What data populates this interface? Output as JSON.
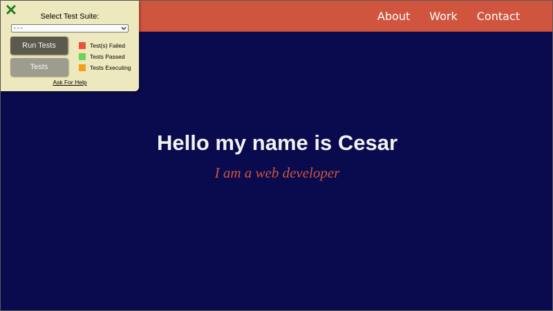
{
  "nav": {
    "links": [
      "About",
      "Work",
      "Contact"
    ]
  },
  "hero": {
    "title": "Hello my name is Cesar",
    "subtitle": "I am a web developer"
  },
  "test_panel": {
    "select_label": "Select Test Suite:",
    "select_value": "- - -",
    "run_button": "Run Tests",
    "tests_button": "Tests",
    "legend": [
      {
        "label": "Test(s) Failed",
        "color": "#e8533f"
      },
      {
        "label": "Tests Passed",
        "color": "#6fd05c"
      },
      {
        "label": "Tests Executing",
        "color": "#f4a01e"
      }
    ],
    "help_link": "Ask For Help",
    "close_icon": "close-x-icon"
  },
  "colors": {
    "background": "#0a0a4f",
    "navbar": "#d0553e",
    "panel": "#ede8bd",
    "subtitle": "#d0553e"
  }
}
